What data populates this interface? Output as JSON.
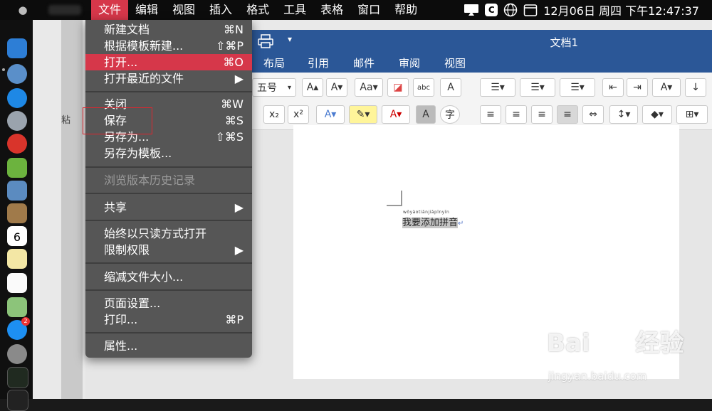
{
  "menubar": {
    "items": [
      "文件",
      "编辑",
      "视图",
      "插入",
      "格式",
      "工具",
      "表格",
      "窗口",
      "帮助"
    ],
    "clock": "12月06日 周四 下午12:47:37",
    "c_icon": "C",
    "calendar_day": "6"
  },
  "word": {
    "doc_title": "文档1",
    "tabs": [
      "布局",
      "引用",
      "邮件",
      "审阅",
      "视图"
    ],
    "font_size": "五号",
    "font_size_options_visible": "五号",
    "doc_text": "我要添加拼音",
    "ruby_text": "wǒyàotiānjiāpīnyīn",
    "side_label": "粘"
  },
  "file_menu": {
    "items": [
      {
        "label": "新建文档",
        "shortcut": "⌘N"
      },
      {
        "label": "根据模板新建...",
        "shortcut": "⇧⌘P"
      },
      {
        "label": "打开...",
        "shortcut": "⌘O"
      },
      {
        "label": "打开最近的文件",
        "shortcut": "▶"
      },
      {
        "label": "关闭",
        "shortcut": "⌘W"
      },
      {
        "label": "保存",
        "shortcut": "⌘S"
      },
      {
        "label": "另存为...",
        "shortcut": "⇧⌘S"
      },
      {
        "label": "另存为模板...",
        "shortcut": ""
      },
      {
        "label": "浏览版本历史记录",
        "shortcut": ""
      },
      {
        "label": "共享",
        "shortcut": "▶"
      },
      {
        "label": "始终以只读方式打开",
        "shortcut": ""
      },
      {
        "label": "限制权限",
        "shortcut": "▶"
      },
      {
        "label": "缩减文件大小...",
        "shortcut": ""
      },
      {
        "label": "页面设置...",
        "shortcut": ""
      },
      {
        "label": "打印...",
        "shortcut": "⌘P"
      },
      {
        "label": "属性...",
        "shortcut": ""
      }
    ],
    "highlighted": "打开...",
    "disabled": "浏览版本历史记录"
  },
  "watermark": {
    "brand": "Bai",
    "brand_cn": "经验",
    "url": "jingyan.baidu.com"
  },
  "colors": {
    "accent": "#d6374a",
    "word_blue": "#2b5797",
    "menu_bg": "#565656"
  },
  "icons": [
    "apple-icon",
    "airplay-icon",
    "globe-icon",
    "calendar-icon",
    "print-icon"
  ]
}
